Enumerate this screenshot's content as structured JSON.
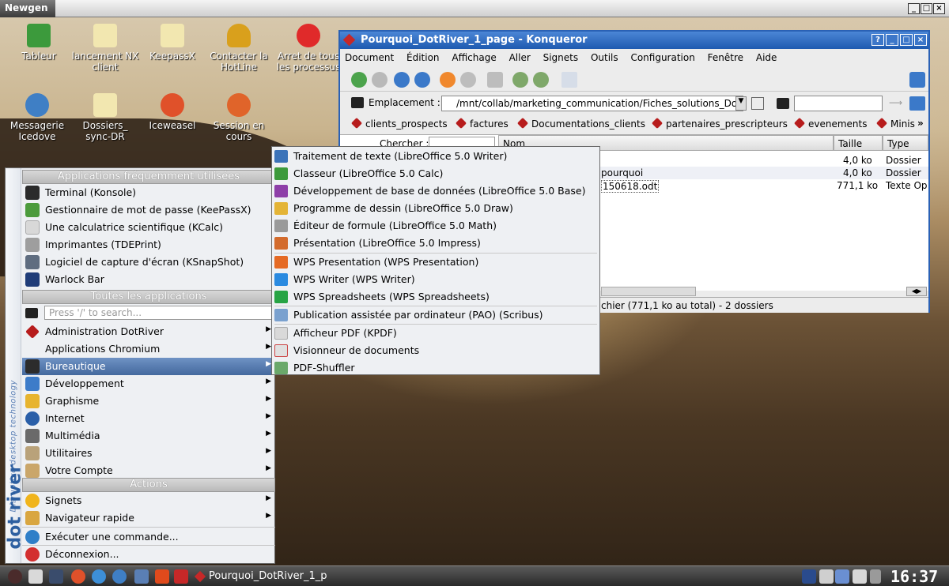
{
  "outer_window": {
    "title": "Newgen"
  },
  "desktop_icons": [
    {
      "label": "Tableur",
      "icon": "spreadsheet-icon"
    },
    {
      "label": "lancement NX client",
      "icon": "script-icon"
    },
    {
      "label": "KeepassX",
      "icon": "script-icon"
    },
    {
      "label": "Contacter la HotLine",
      "icon": "bell-icon"
    },
    {
      "label": "Arret de tous les processus",
      "icon": "stop-icon"
    },
    {
      "label": "Messagerie Icedove",
      "icon": "mail-globe-icon"
    },
    {
      "label": "Dossiers_ sync-DR",
      "icon": "script-icon"
    },
    {
      "label": "Iceweasel",
      "icon": "browser-icon"
    },
    {
      "label": "Session en cours",
      "icon": "users-icon"
    }
  ],
  "konqueror": {
    "title": "Pourquoi_DotRiver_1_page - Konqueror",
    "menu": [
      "Document",
      "Édition",
      "Affichage",
      "Aller",
      "Signets",
      "Outils",
      "Configuration",
      "Fenêtre",
      "Aide"
    ],
    "location_label": "Emplacement :",
    "location_value": "/mnt/collab/marketing_communication/Fiches_solutions_DotI",
    "bookmarks": [
      "clients_prospects",
      "factures",
      "Documentations_clients",
      "partenaires_prescripteurs",
      "evenements",
      "Minis"
    ],
    "bookmarks_more": "»",
    "search_label": "Chercher :",
    "columns": {
      "name": "Nom",
      "size": "Taille",
      "type": "Type de"
    },
    "rows": [
      {
        "name": "",
        "size": "4,0 ko",
        "type": "Dossier"
      },
      {
        "name": "pourquoi",
        "size": "4,0 ko",
        "type": "Dossier"
      },
      {
        "name": "150618.odt",
        "size": "771,1 ko",
        "type": "Texte Op"
      }
    ],
    "status": "chier (771,1 ko au total) - 2 dossiers"
  },
  "start_menu": {
    "side_text": "Disruptive desktop technology",
    "side_brand": "dot river",
    "frequent_header": "Applications fréquemment utilisées",
    "frequent": [
      {
        "label": "Terminal (Konsole)",
        "icon": "terminal-icon"
      },
      {
        "label": "Gestionnaire de mot de passe (KeePassX)",
        "icon": "keepassx-icon"
      },
      {
        "label": "Une calculatrice scientifique (KCalc)",
        "icon": "calculator-icon"
      },
      {
        "label": "Imprimantes (TDEPrint)",
        "icon": "printer-icon"
      },
      {
        "label": "Logiciel de capture d'écran (KSnapShot)",
        "icon": "camera-icon"
      },
      {
        "label": "Warlock Bar",
        "icon": "warlock-icon"
      }
    ],
    "all_header": "Toutes les applications",
    "search_placeholder": "Press '/' to search...",
    "categories": [
      {
        "label": "Administration DotRiver",
        "icon": "dotriver-icon"
      },
      {
        "label": "Applications Chromium",
        "icon": ""
      },
      {
        "label": "Bureautique",
        "icon": "office-icon"
      },
      {
        "label": "Développement",
        "icon": "development-icon"
      },
      {
        "label": "Graphisme",
        "icon": "graphics-icon"
      },
      {
        "label": "Internet",
        "icon": "internet-icon"
      },
      {
        "label": "Multimédia",
        "icon": "multimedia-icon"
      },
      {
        "label": "Utilitaires",
        "icon": "utilities-icon"
      },
      {
        "label": "Votre Compte",
        "icon": "account-icon"
      }
    ],
    "actions_header": "Actions",
    "actions": [
      {
        "label": "Signets",
        "icon": "star-icon"
      },
      {
        "label": "Navigateur rapide",
        "icon": "folder-icon"
      },
      {
        "label": "Exécuter une commande...",
        "icon": "run-icon"
      },
      {
        "label": "Déconnexion...",
        "icon": "logout-icon"
      }
    ]
  },
  "submenu": {
    "items": [
      {
        "label": "Traitement de texte (LibreOffice 5.0 Writer)",
        "icon": "lo-writer-icon",
        "color": "#3b73b9"
      },
      {
        "label": "Classeur (LibreOffice 5.0 Calc)",
        "icon": "lo-calc-icon",
        "color": "#3c9a3c"
      },
      {
        "label": "Développement de base de données (LibreOffice 5.0 Base)",
        "icon": "lo-base-icon",
        "color": "#8e3fa8"
      },
      {
        "label": "Programme de dessin (LibreOffice 5.0 Draw)",
        "icon": "lo-draw-icon",
        "color": "#e4b436"
      },
      {
        "label": "Éditeur de formule (LibreOffice 5.0 Math)",
        "icon": "lo-math-icon",
        "color": "#9a9a9a"
      },
      {
        "label": "Présentation (LibreOffice 5.0 Impress)",
        "icon": "lo-impress-icon",
        "color": "#d36b2d"
      },
      {
        "label": "WPS Presentation (WPS Presentation)",
        "icon": "wps-presentation-icon",
        "color": "#e56a24"
      },
      {
        "label": "WPS Writer (WPS Writer)",
        "icon": "wps-writer-icon",
        "color": "#2a8ae0"
      },
      {
        "label": "WPS Spreadsheets (WPS Spreadsheets)",
        "icon": "wps-spreadsheets-icon",
        "color": "#27a445"
      },
      {
        "label": "Publication assistée par ordinateur (PAO) (Scribus)",
        "icon": "scribus-icon",
        "color": "#7aa1cf"
      },
      {
        "label": "Afficheur PDF (KPDF)",
        "icon": "kpdf-icon",
        "color": "#d9d9d9"
      },
      {
        "label": "Visionneur de documents",
        "icon": "document-viewer-icon",
        "color": "#e0e0e0"
      },
      {
        "label": "PDF-Shuffler",
        "icon": "pdf-shuffler-icon",
        "color": "#6aa86a"
      }
    ]
  },
  "taskbar": {
    "active_window": "Pourquoi_DotRiver_1_p",
    "clock": "16:37"
  }
}
